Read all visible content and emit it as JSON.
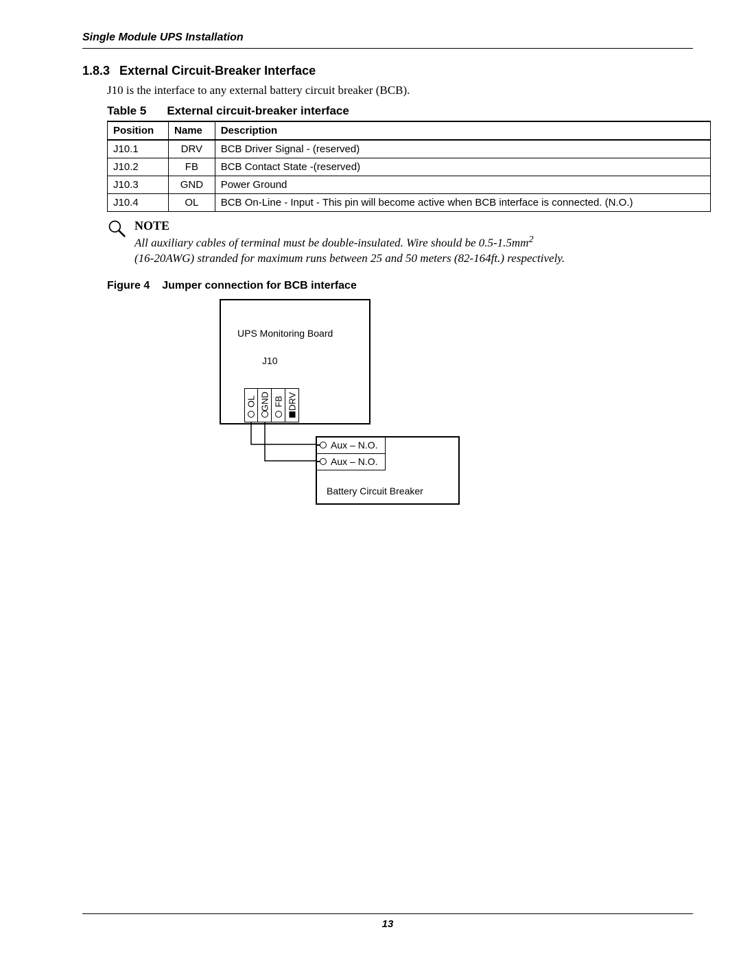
{
  "running_head": "Single Module UPS Installation",
  "section": {
    "number": "1.8.3",
    "title": "External Circuit-Breaker Interface",
    "intro": "J10 is the interface to any external battery circuit breaker (BCB)."
  },
  "table": {
    "label": "Table 5",
    "caption": "External circuit-breaker interface",
    "headers": {
      "position": "Position",
      "name": "Name",
      "description": "Description"
    },
    "rows": [
      {
        "position": "J10.1",
        "name": "DRV",
        "description": "BCB Driver Signal - (reserved)"
      },
      {
        "position": "J10.2",
        "name": "FB",
        "description": "BCB Contact State -(reserved)"
      },
      {
        "position": "J10.3",
        "name": "GND",
        "description": "Power Ground"
      },
      {
        "position": "J10.4",
        "name": "OL",
        "description": "BCB On-Line - Input - This pin will become active when BCB interface is connected. (N.O.)"
      }
    ]
  },
  "note": {
    "label": "NOTE",
    "line1": "All auxiliary cables of terminal must be double-insulated. Wire should be 0.5-1.5mm",
    "sup": "2",
    "line2": "(16-20AWG) stranded for maximum runs between 25 and 50 meters (82-164ft.) respectively."
  },
  "figure": {
    "label": "Figure 4",
    "caption": "Jumper connection for BCB interface",
    "board_label": "UPS Monitoring Board",
    "connector_label": "J10",
    "pins": [
      "OL",
      "GND",
      "FB",
      "DRV"
    ],
    "aux1": "Aux – N.O.",
    "aux2": "Aux – N.O.",
    "bcb_label": "Battery Circuit Breaker"
  },
  "page_number": "13"
}
